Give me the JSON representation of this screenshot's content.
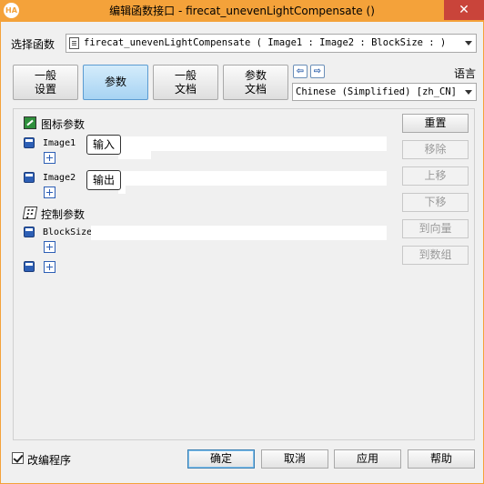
{
  "window": {
    "title": "编辑函数接口 - firecat_unevenLightCompensate ()",
    "app_icon_text": "HA",
    "close_glyph": "✕"
  },
  "function_row": {
    "label": "选择函数",
    "selected": "firecat_unevenLightCompensate ( Image1 : Image2 : BlockSize : )"
  },
  "tabs": [
    {
      "label": "一般\n设置",
      "lines": [
        "一般",
        "设置"
      ]
    },
    {
      "label": "参数"
    },
    {
      "lines": [
        "一般",
        "文档"
      ]
    },
    {
      "lines": [
        "参数",
        "文档"
      ]
    }
  ],
  "language": {
    "label": "语言",
    "selected": "Chinese (Simplified) [zh_CN]",
    "prev_glyph": "⇦",
    "next_glyph": "⇨"
  },
  "params": {
    "icon_section": "图标参数",
    "control_section": "控制参数",
    "image1": {
      "name": "Image1",
      "tooltip": "输入"
    },
    "image2": {
      "name": "Image2",
      "tooltip": "输出"
    },
    "blocksize": {
      "name": "BlockSize"
    }
  },
  "side_buttons": {
    "reset": "重置",
    "remove": "移除",
    "up": "上移",
    "down": "下移",
    "to_vector": "到向量",
    "to_array": "到数组"
  },
  "footer": {
    "checkbox_label": "改编程序",
    "checkbox_checked": true,
    "ok": "确定",
    "cancel": "取消",
    "apply": "应用",
    "help": "帮助"
  }
}
